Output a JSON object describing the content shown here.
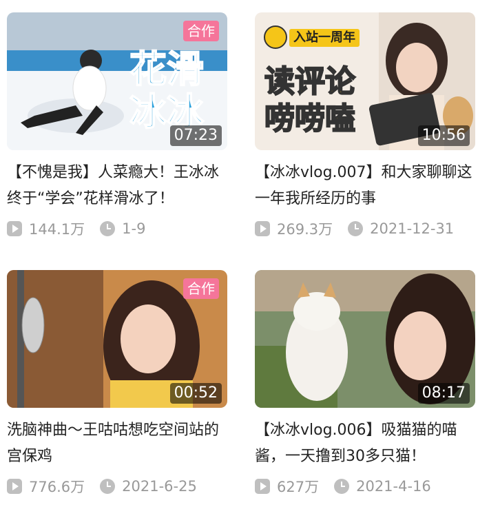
{
  "videos": [
    {
      "title": "【不愧是我】人菜瘾大！王冰冰终于“学会”花样滑冰了！",
      "duration": "07:23",
      "badge": "合作",
      "thumb_text": [
        "花滑",
        "冰冰"
      ],
      "views": "144.1万",
      "date": "1-9"
    },
    {
      "title": "【冰冰vlog.007】和大家聊聊这一年我所经历的事",
      "duration": "10:56",
      "badge": "",
      "thumb_tag": "入站一周年",
      "thumb_text": [
        "读评论",
        "唠唠嗑"
      ],
      "views": "269.3万",
      "date": "2021-12-31"
    },
    {
      "title": "洗脑神曲～王咕咕想吃空间站的宫保鸡",
      "duration": "00:52",
      "badge": "合作",
      "views": "776.6万",
      "date": "2021-6-25"
    },
    {
      "title": "【冰冰vlog.006】吸猫猫的喵酱，一天撸到30多只猫！",
      "duration": "08:17",
      "badge": "",
      "views": "627万",
      "date": "2021-4-16"
    }
  ],
  "colors": {
    "badge": "#f5759a",
    "meta_text": "#999999",
    "accent_yellow": "#f5c518"
  }
}
